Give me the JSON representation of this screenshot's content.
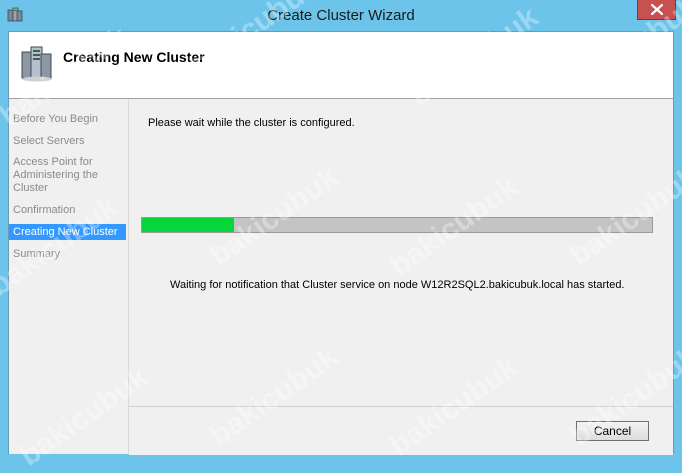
{
  "window": {
    "title": "Create Cluster Wizard",
    "app_icon": "cluster-wizard-icon",
    "close_icon": "close-icon"
  },
  "header": {
    "title": "Creating New Cluster",
    "icon": "server-cluster-icon"
  },
  "steps": [
    {
      "label": "Before You Begin",
      "active": false
    },
    {
      "label": "Select Servers",
      "active": false
    },
    {
      "label": "Access Point for Administering the Cluster",
      "active": false
    },
    {
      "label": "Confirmation",
      "active": false
    },
    {
      "label": "Creating New Cluster",
      "active": true
    },
    {
      "label": "Summary",
      "active": false
    }
  ],
  "content": {
    "wait_message": "Please wait while the cluster is configured.",
    "progress_fraction": 0.18,
    "status_message": "Waiting for notification that Cluster service on node W12R2SQL2.bakicubuk.local has started."
  },
  "footer": {
    "cancel_label": "Cancel"
  },
  "watermark": {
    "text": "bakicubuk"
  },
  "colors": {
    "title_bar": "#6cc4ea",
    "active_step": "#3399ff",
    "progress_fill": "#06d63a",
    "progress_track": "#c4c4c4"
  }
}
